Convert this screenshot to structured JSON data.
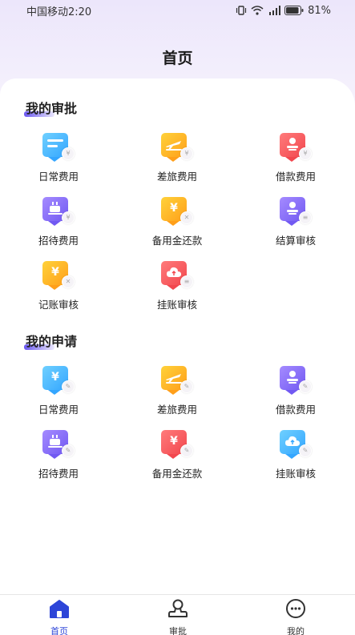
{
  "status": {
    "carrier_time": "中国移动2:20",
    "battery": "81%"
  },
  "page": {
    "title": "首页"
  },
  "approvals": {
    "title": "我的审批",
    "items": [
      {
        "label": "日常费用",
        "color": "blue",
        "icon": "document-icon"
      },
      {
        "label": "差旅费用",
        "color": "orange",
        "icon": "plane-icon"
      },
      {
        "label": "借款费用",
        "color": "red",
        "icon": "person-icon"
      },
      {
        "label": "招待费用",
        "color": "purple",
        "icon": "cup-icon"
      },
      {
        "label": "备用金还款",
        "color": "orange",
        "icon": "yen-icon"
      },
      {
        "label": "结算审核",
        "color": "purple",
        "icon": "person-icon"
      },
      {
        "label": "记账审核",
        "color": "orange",
        "icon": "yen-icon"
      },
      {
        "label": "挂账审核",
        "color": "red",
        "icon": "cloud-icon"
      }
    ]
  },
  "applications": {
    "title": "我的申请",
    "items": [
      {
        "label": "日常费用",
        "color": "blue",
        "icon": "yen-icon"
      },
      {
        "label": "差旅费用",
        "color": "orange",
        "icon": "plane-icon"
      },
      {
        "label": "借款费用",
        "color": "purple",
        "icon": "person-icon"
      },
      {
        "label": "招待费用",
        "color": "purple",
        "icon": "cup-icon"
      },
      {
        "label": "备用金还款",
        "color": "red",
        "icon": "yen-icon"
      },
      {
        "label": "挂账审核",
        "color": "blue",
        "icon": "cloud-icon"
      }
    ]
  },
  "tabbar": {
    "items": [
      {
        "label": "首页",
        "icon": "home-icon",
        "active": true
      },
      {
        "label": "审批",
        "icon": "approval-stamp-icon",
        "active": false
      },
      {
        "label": "我的",
        "icon": "profile-chat-icon",
        "active": false
      }
    ]
  },
  "colors": {
    "accent": "#2d45d8",
    "blue": "#34a6ff",
    "orange": "#ff9f1a",
    "red": "#f2474e",
    "purple": "#7159f2"
  }
}
